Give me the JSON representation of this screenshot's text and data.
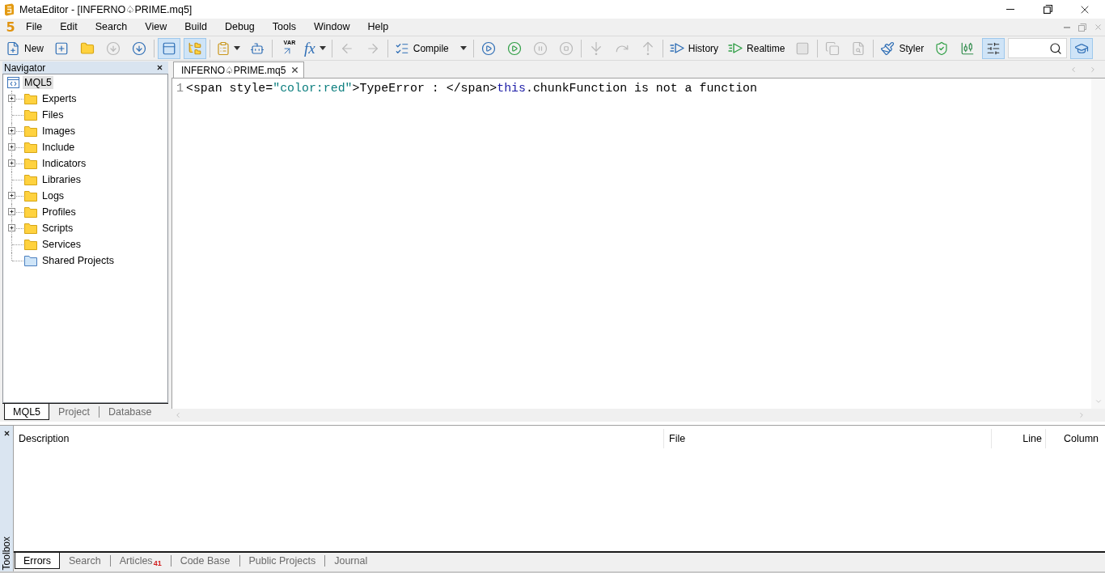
{
  "window": {
    "title": "MetaEditor - [INFERNO♤PRIME.mq5]"
  },
  "menu_bar": {
    "logo": "5",
    "items": [
      "File",
      "Edit",
      "Search",
      "View",
      "Build",
      "Debug",
      "Tools",
      "Window",
      "Help"
    ]
  },
  "toolbar": {
    "groups": [
      [
        {
          "kind": "labeled",
          "label": "New",
          "disabled": false,
          "pressed": false,
          "dropdown": false
        },
        {
          "kind": "icon",
          "disabled": false,
          "pressed": false,
          "dropdown": false
        },
        {
          "kind": "icon",
          "disabled": false,
          "pressed": false,
          "dropdown": false
        },
        {
          "kind": "icon",
          "disabled": true,
          "pressed": false,
          "dropdown": false
        },
        {
          "kind": "icon",
          "disabled": false,
          "pressed": false,
          "dropdown": false
        }
      ],
      [
        {
          "kind": "icon",
          "disabled": false,
          "pressed": true,
          "dropdown": false
        },
        {
          "kind": "icon",
          "disabled": false,
          "pressed": true,
          "dropdown": false
        }
      ],
      [
        {
          "kind": "icon",
          "disabled": false,
          "pressed": false,
          "dropdown": true
        },
        {
          "kind": "icon",
          "disabled": false,
          "pressed": false,
          "dropdown": false
        }
      ],
      [
        {
          "kind": "tag",
          "label": "VAR",
          "disabled": false,
          "pressed": false,
          "dropdown": false
        },
        {
          "kind": "glyph",
          "label": "fx",
          "disabled": false,
          "pressed": false,
          "dropdown": true
        }
      ],
      [
        {
          "kind": "icon",
          "disabled": true,
          "pressed": false,
          "dropdown": false
        },
        {
          "kind": "icon",
          "disabled": true,
          "pressed": false,
          "dropdown": false
        }
      ],
      [
        {
          "kind": "labeled",
          "label": "Compile",
          "disabled": false,
          "pressed": false,
          "dropdown": true
        }
      ],
      [
        {
          "kind": "icon",
          "disabled": false,
          "pressed": false,
          "dropdown": false
        },
        {
          "kind": "icon",
          "disabled": false,
          "pressed": false,
          "dropdown": false
        },
        {
          "kind": "icon",
          "disabled": true,
          "pressed": false,
          "dropdown": false
        },
        {
          "kind": "icon",
          "disabled": true,
          "pressed": false,
          "dropdown": false
        }
      ],
      [
        {
          "kind": "icon",
          "disabled": true,
          "pressed": false,
          "dropdown": false
        },
        {
          "kind": "icon",
          "disabled": true,
          "pressed": false,
          "dropdown": false
        },
        {
          "kind": "icon",
          "disabled": true,
          "pressed": false,
          "dropdown": false
        }
      ],
      [
        {
          "kind": "labeled",
          "label": "History",
          "disabled": false,
          "pressed": false,
          "dropdown": false
        },
        {
          "kind": "labeled",
          "label": "Realtime",
          "disabled": false,
          "pressed": false,
          "dropdown": false
        },
        {
          "kind": "icon",
          "disabled": true,
          "pressed": false,
          "dropdown": false
        }
      ],
      [
        {
          "kind": "icon",
          "disabled": true,
          "pressed": false,
          "dropdown": false
        },
        {
          "kind": "icon",
          "disabled": true,
          "pressed": false,
          "dropdown": false
        }
      ],
      [
        {
          "kind": "labeled",
          "label": "Styler",
          "disabled": false,
          "pressed": false,
          "dropdown": false
        },
        {
          "kind": "icon",
          "disabled": false,
          "pressed": false,
          "dropdown": false
        },
        {
          "kind": "icon",
          "disabled": false,
          "pressed": false,
          "dropdown": false
        },
        {
          "kind": "icon",
          "disabled": false,
          "pressed": true,
          "dropdown": false
        },
        {
          "kind": "search"
        },
        {
          "kind": "icon",
          "disabled": false,
          "pressed": true,
          "dropdown": false
        }
      ]
    ]
  },
  "navigator": {
    "title": "Navigator",
    "tree": [
      {
        "label": "MQL5",
        "kind": "root",
        "selected": true,
        "expandable": false,
        "children": [
          {
            "label": "Experts",
            "kind": "folder",
            "selected": false,
            "expandable": true
          },
          {
            "label": "Files",
            "kind": "folder",
            "selected": false,
            "expandable": false
          },
          {
            "label": "Images",
            "kind": "folder",
            "selected": false,
            "expandable": true
          },
          {
            "label": "Include",
            "kind": "folder",
            "selected": false,
            "expandable": true
          },
          {
            "label": "Indicators",
            "kind": "folder",
            "selected": false,
            "expandable": true
          },
          {
            "label": "Libraries",
            "kind": "folder",
            "selected": false,
            "expandable": false
          },
          {
            "label": "Logs",
            "kind": "folder",
            "selected": false,
            "expandable": true
          },
          {
            "label": "Profiles",
            "kind": "folder",
            "selected": false,
            "expandable": true
          },
          {
            "label": "Scripts",
            "kind": "folder",
            "selected": false,
            "expandable": true
          },
          {
            "label": "Services",
            "kind": "folder",
            "selected": false,
            "expandable": false
          },
          {
            "label": "Shared Projects",
            "kind": "shared",
            "selected": false,
            "expandable": false
          }
        ]
      }
    ],
    "tabs": [
      {
        "label": "MQL5",
        "selected": true
      },
      {
        "label": "Project",
        "selected": false
      },
      {
        "label": "Database",
        "selected": false
      }
    ]
  },
  "editor": {
    "tabs": [
      {
        "label": "INFERNO♤PRIME.mq5",
        "selected": true
      }
    ],
    "lines": [
      {
        "number": "1",
        "tokens": [
          {
            "kind": "plain",
            "text": "<span style="
          },
          {
            "kind": "string",
            "text": "\"color:red\""
          },
          {
            "kind": "plain",
            "text": ">TypeError : </span>"
          },
          {
            "kind": "keyword",
            "text": "this"
          },
          {
            "kind": "plain",
            "text": ".chunkFunction is not a function"
          }
        ]
      }
    ]
  },
  "toolbox": {
    "title": "Toolbox",
    "columns": [
      "Description",
      "File",
      "Line",
      "Column"
    ],
    "tabs": [
      {
        "label": "Errors",
        "selected": true
      },
      {
        "label": "Search",
        "selected": false
      },
      {
        "label": "Articles",
        "badge": "41",
        "selected": false
      },
      {
        "label": "Code Base",
        "selected": false
      },
      {
        "label": "Public Projects",
        "selected": false
      },
      {
        "label": "Journal",
        "selected": false
      }
    ]
  }
}
